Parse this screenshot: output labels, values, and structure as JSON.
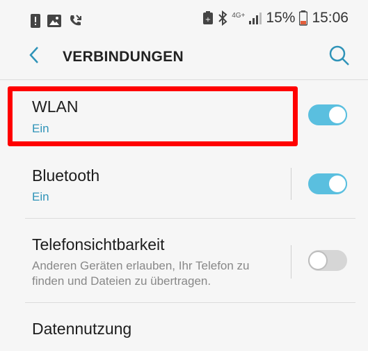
{
  "status_bar": {
    "left_icons": [
      "alert-icon",
      "image-icon",
      "missed-call-icon"
    ],
    "network": "4G+",
    "battery_percent": "15%",
    "time": "15:06"
  },
  "header": {
    "title": "VERBINDUNGEN"
  },
  "settings": [
    {
      "title": "WLAN",
      "subtitle": "Ein",
      "toggle_on": true
    },
    {
      "title": "Bluetooth",
      "subtitle": "Ein",
      "toggle_on": true
    },
    {
      "title": "Telefonsichtbarkeit",
      "description": "Anderen Geräten erlauben, Ihr Telefon zu finden und Dateien zu übertragen.",
      "toggle_on": false
    },
    {
      "title": "Datennutzung"
    }
  ],
  "colors": {
    "accent": "#2f93b8",
    "toggle_on": "#5abfdf",
    "highlight": "#ff0000"
  }
}
